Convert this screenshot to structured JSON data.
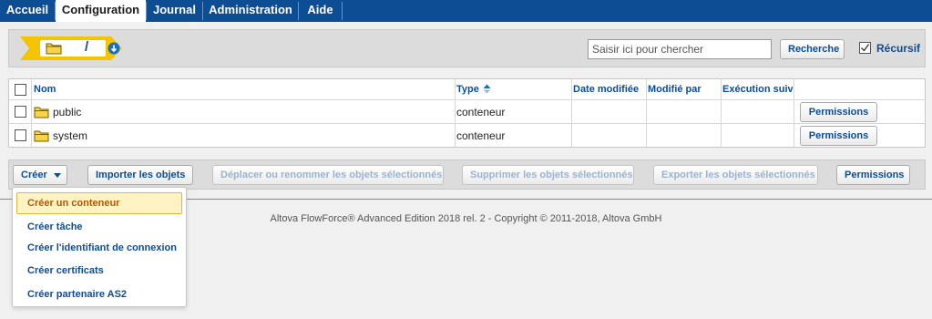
{
  "topnav": {
    "tabs": [
      {
        "label": "Accueil"
      },
      {
        "label": "Configuration"
      },
      {
        "label": "Journal"
      },
      {
        "label": "Administration"
      },
      {
        "label": "Aide"
      }
    ]
  },
  "breadcrumb": {
    "path": "/"
  },
  "search": {
    "placeholder": "Saisir ici pour chercher",
    "button_label": "Recherche",
    "recursive_label": "Récursif",
    "recursive_checked": true
  },
  "table": {
    "columns": {
      "name": "Nom",
      "type": "Type",
      "date_modified": "Date modifiée",
      "modified_by": "Modifié par",
      "next_run": "Exécution suiv"
    },
    "rows": [
      {
        "name": "public",
        "type": "conteneur",
        "action": "Permissions"
      },
      {
        "name": "system",
        "type": "conteneur",
        "action": "Permissions"
      }
    ]
  },
  "actions": {
    "create": "Créer",
    "import": "Importer les objets",
    "move": "Déplacer ou renommer les objets sélectionnés",
    "delete": "Supprimer les objets sélectionnés",
    "export": "Exporter les objets sélectionnés",
    "permissions": "Permissions"
  },
  "create_menu": {
    "items": [
      {
        "label": "Créer un conteneur"
      },
      {
        "label": "Créer tâche"
      },
      {
        "label": "Créer l'identifiant de connexion"
      },
      {
        "label": "Créer certificats"
      },
      {
        "label": "Créer partenaire AS2"
      }
    ]
  },
  "footer": {
    "copyright": "Altova FlowForce® Advanced Edition 2018 rel. 2 - Copyright © 2011-2018, Altova GmbH"
  },
  "colors": {
    "nav_bg": "#0c4d94",
    "link": "#0c4d94",
    "breadcrumb_bg": "#f5c400",
    "menu_highlight_bg": "#fff3c4"
  }
}
